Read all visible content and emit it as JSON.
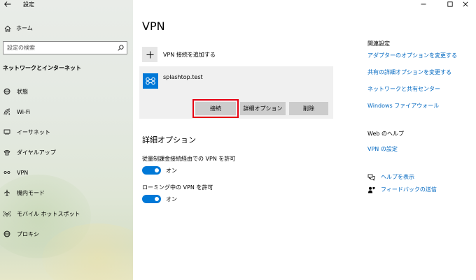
{
  "window": {
    "title": "設定",
    "controls": [
      "minimize",
      "maximize",
      "close"
    ]
  },
  "sidebar": {
    "home_label": "ホーム",
    "search_placeholder": "設定の検索",
    "section_title": "ネットワークとインターネット",
    "items": [
      {
        "label": "状態",
        "icon": "globe-icon"
      },
      {
        "label": "Wi-Fi",
        "icon": "wifi-icon"
      },
      {
        "label": "イーサネット",
        "icon": "ethernet-icon"
      },
      {
        "label": "ダイヤルアップ",
        "icon": "dialup-icon"
      },
      {
        "label": "VPN",
        "icon": "vpn-icon"
      },
      {
        "label": "機内モード",
        "icon": "airplane-icon"
      },
      {
        "label": "モバイル ホットスポット",
        "icon": "hotspot-icon"
      },
      {
        "label": "プロキシ",
        "icon": "globe-icon"
      }
    ]
  },
  "main": {
    "title": "VPN",
    "add_vpn_label": "VPN 接続を追加する",
    "vpn_connection": {
      "name": "splashtop.test",
      "connect_label": "接続",
      "advanced_label": "詳細オプション",
      "delete_label": "削除"
    },
    "advanced_title": "詳細オプション",
    "options": [
      {
        "label": "従量制課金接続経由での VPN を許可",
        "state": "オン",
        "on": true
      },
      {
        "label": "ローミング中の VPN を許可",
        "state": "オン",
        "on": true
      }
    ]
  },
  "related": {
    "title": "関連設定",
    "links": [
      "アダプターのオプションを変更する",
      "共有の詳細オプションを変更する",
      "ネットワークと共有センター",
      "Windows ファイアウォール"
    ]
  },
  "web_help": {
    "title": "Web のヘルプ",
    "link": "VPN の設定"
  },
  "help": {
    "get_help": "ヘルプを表示",
    "feedback": "フィードバックの送信"
  },
  "colors": {
    "accent": "#0078d7",
    "link": "#0067c0",
    "highlight": "#e60012"
  }
}
